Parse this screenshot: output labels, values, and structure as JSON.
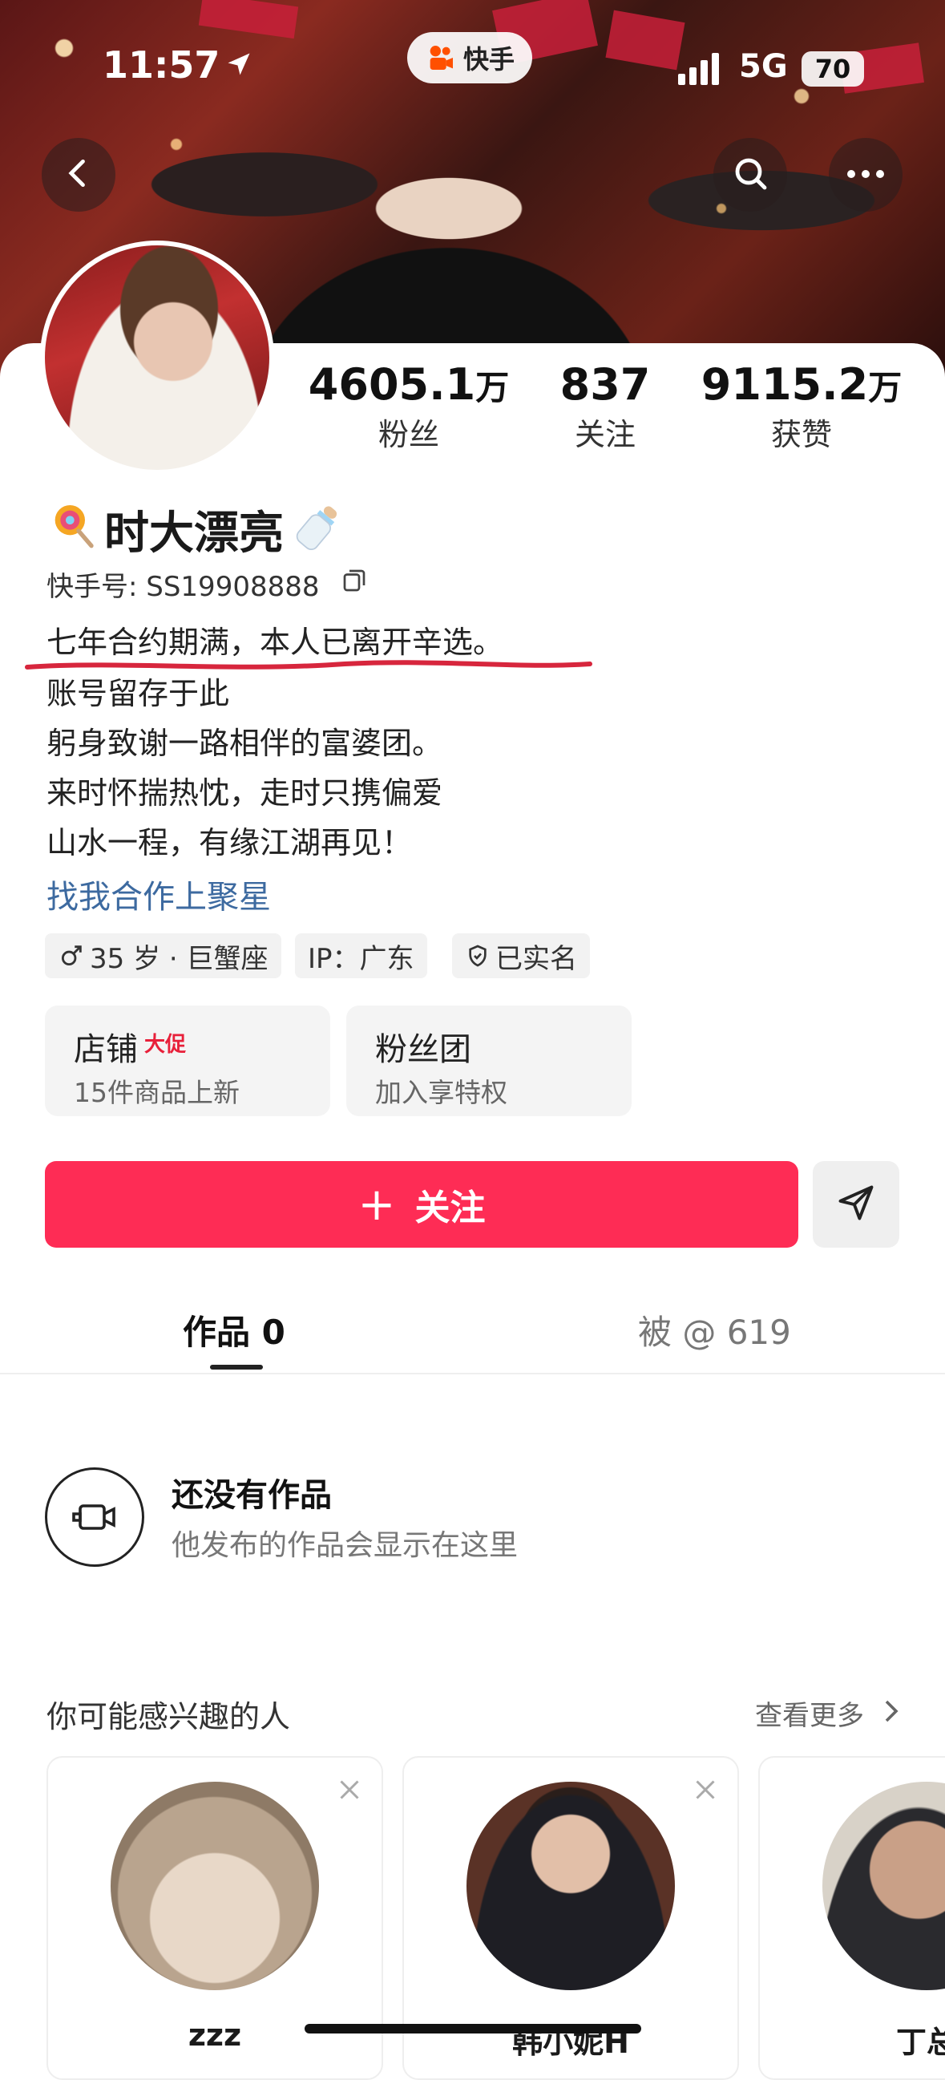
{
  "status_bar": {
    "time": "11:57",
    "network": "5G",
    "battery": "70"
  },
  "app": {
    "name": "快手"
  },
  "profile": {
    "stats": [
      {
        "number": "4605.1",
        "unit": "万",
        "label": "粉丝"
      },
      {
        "number": "837",
        "unit": "",
        "label": "关注"
      },
      {
        "number": "9115.2",
        "unit": "万",
        "label": "获赞"
      }
    ],
    "name": "时大漂亮",
    "id_label": "快手号: SS19908888",
    "bio": [
      "七年合约期满，本人已离开辛选。",
      "账号留存于此",
      "躬身致谢一路相伴的富婆团。",
      "来时怀揣热忱，走时只携偏爱",
      "山水一程，有缘江湖再见！"
    ],
    "link": "找我合作上聚星",
    "tags": [
      "35 岁 · 巨蟹座",
      "IP：广东",
      "已实名"
    ]
  },
  "cards": {
    "shop": {
      "title": "店铺",
      "badge": "大促",
      "sub": "15件商品上新"
    },
    "fans": {
      "title": "粉丝团",
      "sub": "加入享特权"
    }
  },
  "actions": {
    "follow": "关注",
    "follow_plus": "+"
  },
  "tabs": {
    "works": "作品 0",
    "mentioned": "被 @ 619"
  },
  "empty": {
    "title": "还没有作品",
    "sub": "他发布的作品会显示在这里"
  },
  "suggest": {
    "title": "你可能感兴趣的人",
    "more": "查看更多",
    "users": [
      {
        "name": "zzz"
      },
      {
        "name": "韩小妮H"
      },
      {
        "name": "丁总"
      }
    ]
  },
  "colors": {
    "accent": "#fe2c55",
    "link": "#3d6aa0",
    "underline": "#d7263d"
  }
}
